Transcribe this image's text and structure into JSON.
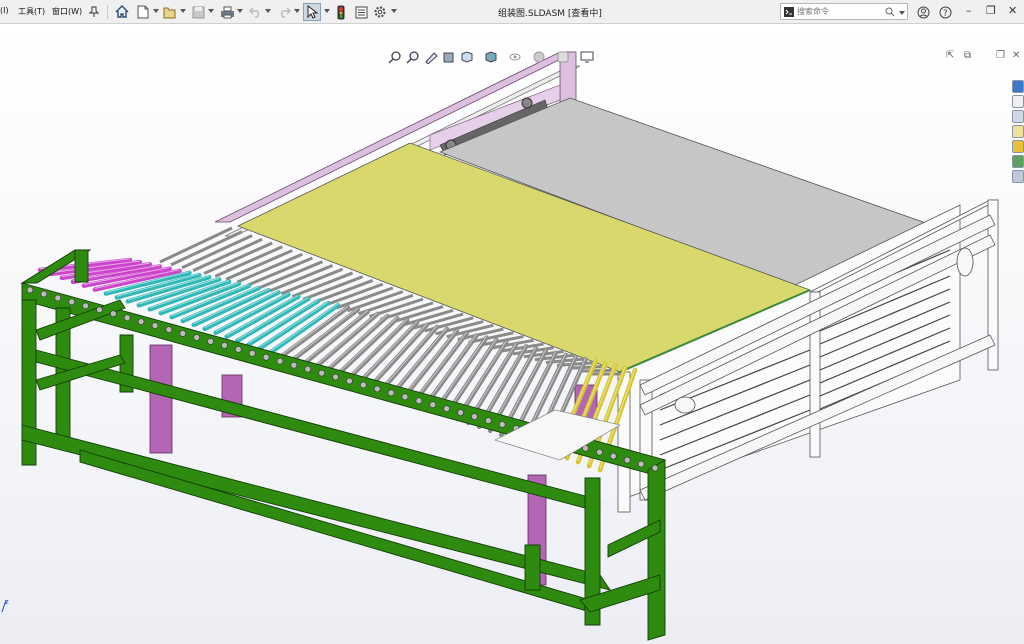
{
  "menus": {
    "left_partial": "(I)",
    "tools": "工具(T)",
    "window": "窗口(W)"
  },
  "title": "组装图.SLDASM [查看中]",
  "search": {
    "label": "搜索命令"
  },
  "triad": {
    "z": "z"
  },
  "colors": {
    "frame_green": "#2e8b10",
    "roller_magenta": "#cc44cc",
    "roller_teal": "#2fb8b8",
    "roller_grey": "#8a8a8a",
    "roller_yellow": "#d6c62a",
    "plate_yellow": "#d8d86c",
    "plate_grey": "#c6c6c6",
    "leg_purple": "#b366b3",
    "rack_lavender": "#ddbfe0"
  },
  "icons": [
    "home-icon",
    "new-document-icon",
    "open-icon",
    "save-icon",
    "print-icon",
    "undo-icon",
    "redo-icon",
    "select-cursor-icon",
    "traffic-light-icon",
    "options-list-icon",
    "settings-gear-icon",
    "zoom-to-fit-icon",
    "zoom-area-icon",
    "previous-view-icon",
    "section-view-icon",
    "view-orientation-icon",
    "display-style-icon",
    "hide-show-icon",
    "appearance-icon",
    "scene-icon",
    "view-settings-icon"
  ]
}
